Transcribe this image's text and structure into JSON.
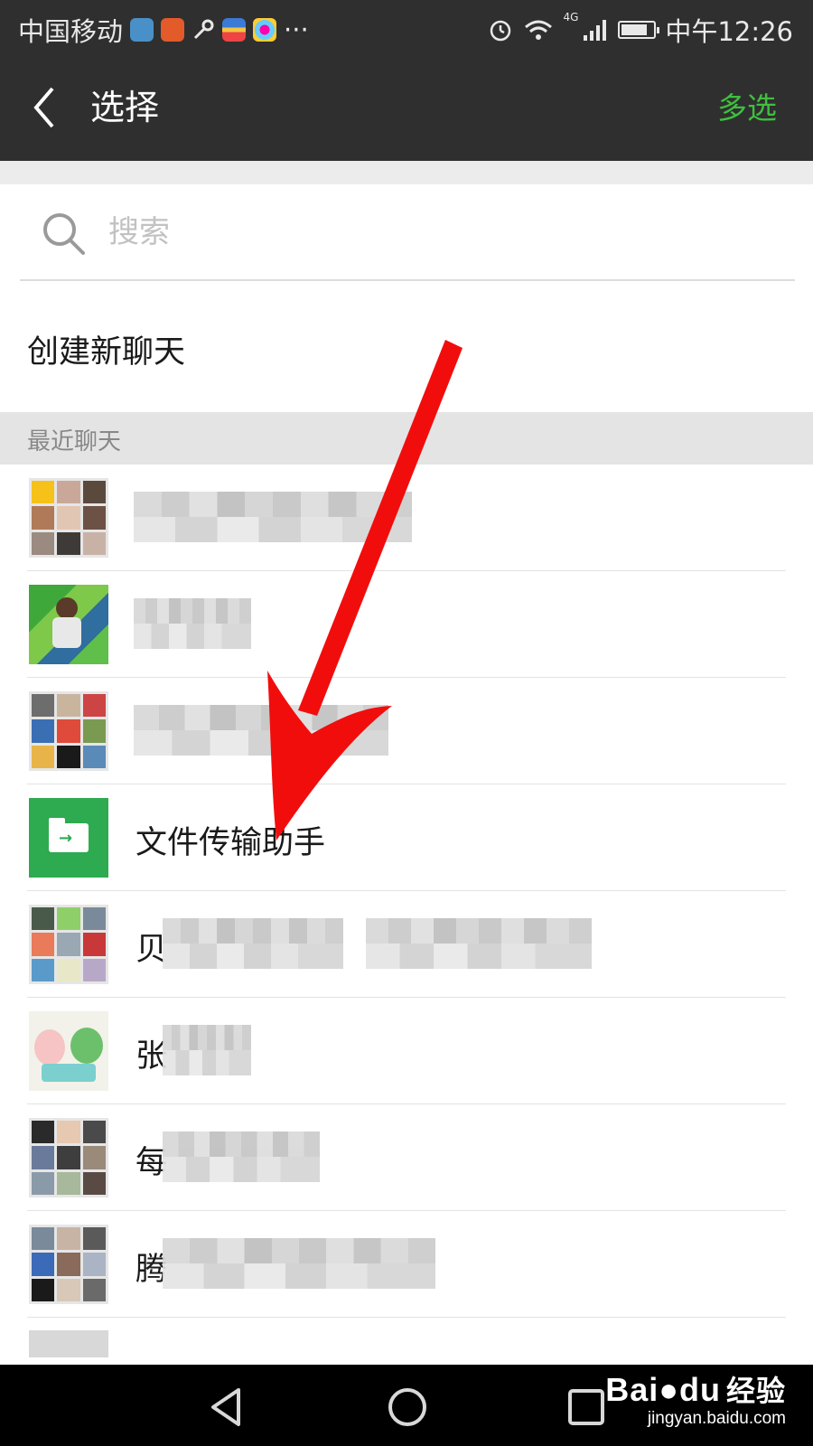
{
  "status_bar": {
    "carrier": "中国移动",
    "more": "···",
    "network": "4G",
    "time": "中午12:26",
    "battery_level": 0.8
  },
  "header": {
    "title": "选择",
    "multi_select": "多选"
  },
  "search": {
    "placeholder": "搜索"
  },
  "create_chat": {
    "label": "创建新聊天"
  },
  "recent": {
    "header": "最近聊天",
    "items": [
      {
        "name": "",
        "avatar": "group-grid"
      },
      {
        "name": "",
        "avatar": "photo"
      },
      {
        "name": "",
        "avatar": "group-grid"
      },
      {
        "name": "文件传输助手",
        "avatar": "file-transfer"
      },
      {
        "name": "贝",
        "avatar": "group-grid"
      },
      {
        "name": "张",
        "avatar": "cartoon"
      },
      {
        "name": "每",
        "avatar": "group-grid"
      },
      {
        "name": "腾",
        "avatar": "group-grid"
      }
    ]
  },
  "watermark": {
    "logo": "Bai",
    "logo_suffix": "du",
    "logo_cn": "经验",
    "url": "jingyan.baidu.com"
  },
  "colors": {
    "accent_green": "#3fbf3f",
    "file_green": "#2eaa50",
    "annotation_red": "#f20d0d"
  }
}
